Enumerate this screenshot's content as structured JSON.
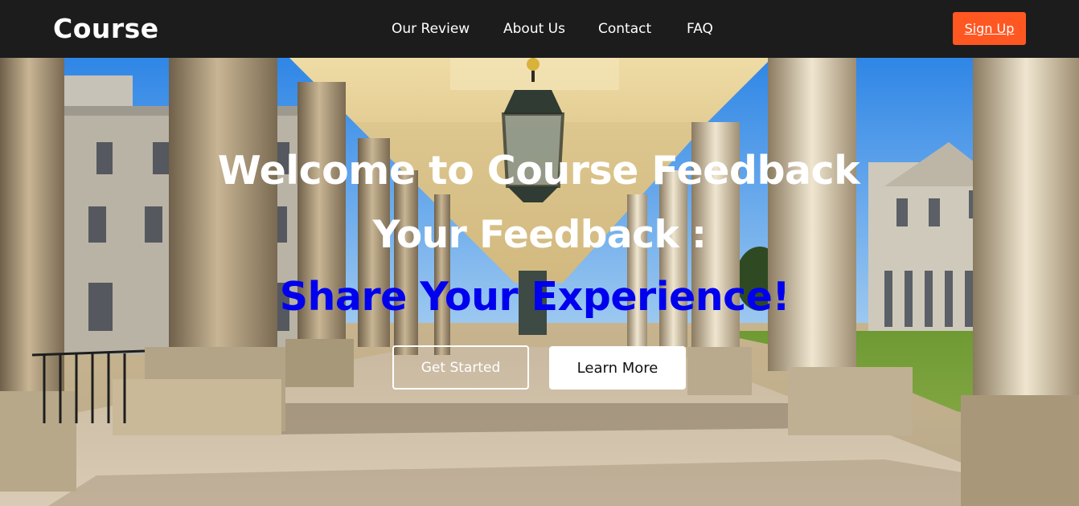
{
  "nav": {
    "brand": "Course",
    "links": [
      "Our Review",
      "About Us",
      "Contact",
      "FAQ"
    ],
    "signup_label": "Sign Up"
  },
  "hero": {
    "title_line1": "Welcome to Course Feedback",
    "title_line2": "Your Feedback :",
    "title_line3": "Share Your Experience!",
    "primary_button": "Get Started",
    "secondary_button": "Learn More",
    "background_image": "colonnade-photo"
  },
  "colors": {
    "nav_background": "#1c1c1c",
    "accent": "#ff5722",
    "highlight_text": "#0000ee",
    "text_white": "#ffffff"
  }
}
